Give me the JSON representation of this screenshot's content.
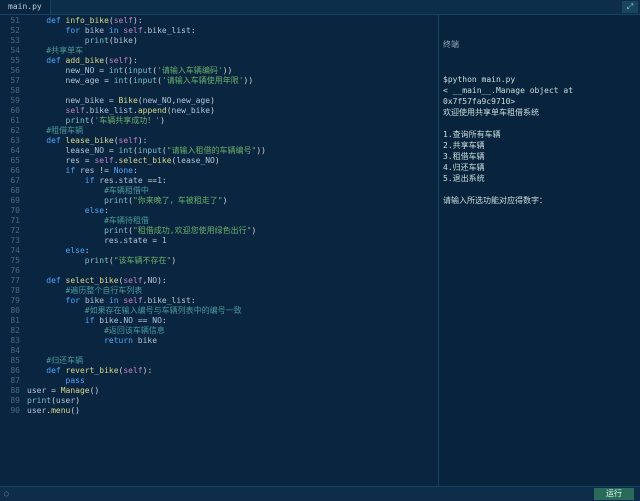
{
  "tab": {
    "filename": "main.py"
  },
  "winbtn": {
    "glyph": "⤢"
  },
  "gutter": {
    "start": 51,
    "end": 90
  },
  "code_lines": [
    {
      "i": 0,
      "h": "    <span class='kw'>def</span> <span class='fn'>info_bike</span>(<span class='sl'>self</span>):"
    },
    {
      "i": 0,
      "h": "        <span class='kw'>for</span> <span class='nm'>bike</span> <span class='kw'>in</span> <span class='sl'>self</span>.<span class='nm'>bike_list</span>:"
    },
    {
      "i": 0,
      "h": "            <span class='bi'>print</span>(<span class='nm'>bike</span>)"
    },
    {
      "i": 0,
      "h": "    <span class='cm'>#共享单车</span>"
    },
    {
      "i": 0,
      "h": "    <span class='kw'>def</span> <span class='fn'>add_bike</span>(<span class='sl'>self</span>):"
    },
    {
      "i": 0,
      "h": "        <span class='nm'>new_NO</span> = <span class='bi'>int</span>(<span class='bi'>input</span>(<span class='st'>'请输入车辆编码'</span>))"
    },
    {
      "i": 0,
      "h": "        <span class='nm'>new_age</span> = <span class='bi'>int</span>(<span class='bi'>input</span>(<span class='st'>'请输入车辆使用年限'</span>))"
    },
    {
      "i": 0,
      "h": ""
    },
    {
      "i": 0,
      "h": "        <span class='nm'>new_bike</span> = <span class='fn'>Bike</span>(<span class='nm'>new_NO</span>,<span class='nm'>new_age</span>)"
    },
    {
      "i": 0,
      "h": "        <span class='sl'>self</span>.<span class='nm'>bike_list</span>.<span class='fn'>append</span>(<span class='nm'>new_bike</span>)"
    },
    {
      "i": 0,
      "h": "        <span class='bi'>print</span>(<span class='st'>'车辆共享成功！'</span>)"
    },
    {
      "i": 0,
      "h": "    <span class='cm'>#租借车辆</span>"
    },
    {
      "i": 0,
      "h": "    <span class='kw'>def</span> <span class='fn'>lease_bike</span>(<span class='sl'>self</span>):"
    },
    {
      "i": 0,
      "h": "        <span class='nm'>lease_NO</span> = <span class='bi'>int</span>(<span class='bi'>input</span>(<span class='st'>\"请输入租借的车辆编号\"</span>))"
    },
    {
      "i": 0,
      "h": "        <span class='nm'>res</span> = <span class='sl'>self</span>.<span class='fn'>select_bike</span>(<span class='nm'>lease_NO</span>)"
    },
    {
      "i": 0,
      "h": "        <span class='kw'>if</span> <span class='nm'>res</span> != <span class='kw'>None</span>:"
    },
    {
      "i": 0,
      "h": "            <span class='kw'>if</span> <span class='nm'>res</span>.<span class='nm'>state</span> ==<span class='nm'>1</span>:"
    },
    {
      "i": 0,
      "h": "                <span class='cm'>#车辆租借中</span>"
    },
    {
      "i": 0,
      "h": "                <span class='bi'>print</span>(<span class='st'>\"你来晚了，车被租走了\"</span>)"
    },
    {
      "i": 0,
      "h": "            <span class='kw'>else</span>:"
    },
    {
      "i": 0,
      "h": "                <span class='cm'>#车辆待租借</span>"
    },
    {
      "i": 0,
      "h": "                <span class='bi'>print</span>(<span class='st'>\"租借成功,欢迎您使用绿色出行\"</span>)"
    },
    {
      "i": 0,
      "h": "                <span class='nm'>res</span>.<span class='nm'>state</span> = <span class='nm'>1</span>"
    },
    {
      "i": 0,
      "h": "        <span class='kw'>else</span>:"
    },
    {
      "i": 0,
      "h": "            <span class='bi'>print</span>(<span class='st'>\"该车辆不存在\"</span>)"
    },
    {
      "i": 0,
      "h": ""
    },
    {
      "i": 0,
      "h": "    <span class='kw'>def</span> <span class='fn'>select_bike</span>(<span class='sl'>self</span>,<span class='nm'>NO</span>):"
    },
    {
      "i": 0,
      "h": "        <span class='cm'>#遍历整个自行车列表</span>"
    },
    {
      "i": 0,
      "h": "        <span class='kw'>for</span> <span class='nm'>bike</span> <span class='kw'>in</span> <span class='sl'>self</span>.<span class='nm'>bike_list</span>:"
    },
    {
      "i": 0,
      "h": "            <span class='cm'>#如果存在输入编号与车辆列表中的编号一致</span>"
    },
    {
      "i": 0,
      "h": "            <span class='kw'>if</span> <span class='nm'>bike</span>.<span class='nm'>NO</span> == <span class='nm'>NO</span>:"
    },
    {
      "i": 0,
      "h": "                <span class='cm'>#返回该车辆信息</span>"
    },
    {
      "i": 0,
      "h": "                <span class='kw'>return</span> <span class='nm'>bike</span>"
    },
    {
      "i": 0,
      "h": ""
    },
    {
      "i": 0,
      "h": "    <span class='cm'>#归还车辆</span>"
    },
    {
      "i": 0,
      "h": "    <span class='kw'>def</span> <span class='fn'>revert_bike</span>(<span class='sl'>self</span>):"
    },
    {
      "i": 0,
      "h": "        <span class='kw'>pass</span>"
    },
    {
      "i": 0,
      "h": "<span class='nm'>user</span> = <span class='fn'>Manage</span>()"
    },
    {
      "i": 0,
      "h": "<span class='bi'>print</span>(<span class='nm'>user</span>)"
    },
    {
      "i": 0,
      "h": "<span class='nm'>user</span>.<span class='fn'>menu</span>()"
    }
  ],
  "terminal": {
    "title": "终端",
    "lines": [
      "$python main.py",
      "< __main__.Manage object at 0x7f57fa9c9710>",
      "欢迎使用共享单车租借系统",
      "",
      "1.查询所有车辆",
      "2.共享车辆",
      "3.租借车辆",
      "4.归还车辆",
      "5.退出系统",
      "",
      "请输入所选功能对应得数字："
    ]
  },
  "status": {
    "spin": "◌",
    "run": "运行"
  }
}
